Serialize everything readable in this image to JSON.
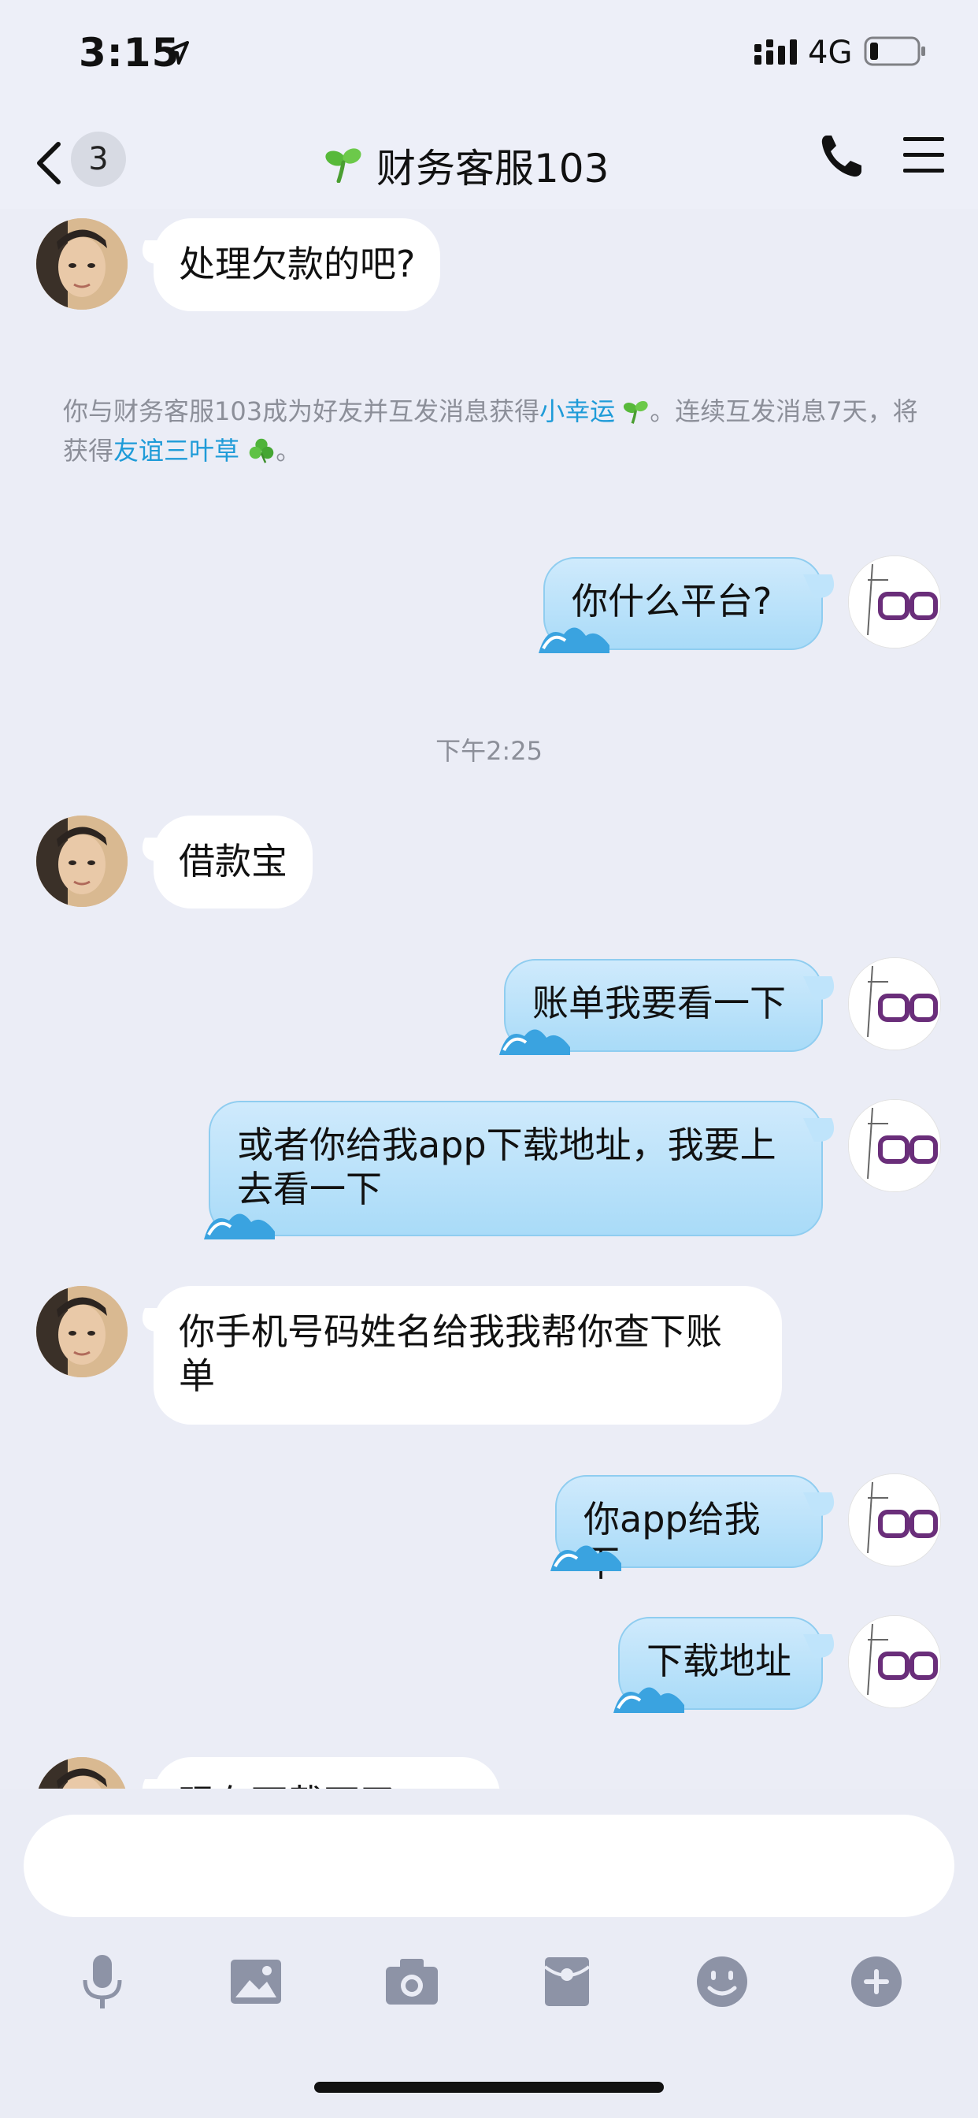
{
  "status_bar": {
    "time": "3:15",
    "network": "4G"
  },
  "nav": {
    "unread_count": "3",
    "title": "财务客服103"
  },
  "messages": [
    {
      "side": "in",
      "text": "处理欠款的吧?"
    },
    {
      "side": "out",
      "text": "你什么平台?"
    },
    {
      "side": "in",
      "text": "借款宝"
    },
    {
      "side": "out",
      "text": "账单我要看一下"
    },
    {
      "side": "out",
      "text": "或者你给我app下载地址，我要上去看一下"
    },
    {
      "side": "in",
      "text": "你手机号码姓名给我我帮你查下账单"
    },
    {
      "side": "out",
      "text": "你app给我下"
    },
    {
      "side": "out",
      "text": "下载地址"
    },
    {
      "side": "in",
      "text": "现在下载不了"
    }
  ],
  "notice": {
    "part1": "你与财务客服103成为好友并互发消息获得",
    "link1": "小幸运",
    "part2": "。连续互发消息7天，将获得",
    "link2": "友谊三叶草",
    "part3": "。"
  },
  "timestamp": "下午2:25",
  "input": {
    "placeholder": ""
  },
  "toolbar": [
    "microphone-icon",
    "image-icon",
    "camera-icon",
    "red-packet-icon",
    "emoji-icon",
    "plus-icon"
  ],
  "colors": {
    "outgoing_bubble": "#b4dff9",
    "incoming_bubble": "#ffffff",
    "link": "#1e9bd8",
    "background": "#ebedf6"
  }
}
